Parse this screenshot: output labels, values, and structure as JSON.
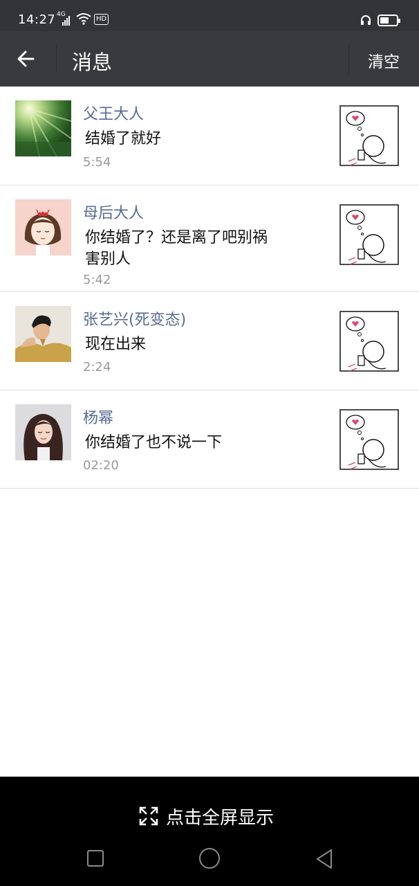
{
  "status_bar": {
    "time": "14:27",
    "signal": "4G",
    "hd": "HD",
    "battery_level": 0.55,
    "icons": [
      "signal-icon",
      "wifi-icon",
      "hd-icon",
      "headset-icon",
      "battery-icon"
    ]
  },
  "header": {
    "title": "消息",
    "clear_label": "清空",
    "back_icon": "back-arrow-icon"
  },
  "messages": [
    {
      "sender": "父王大人",
      "text": "结婚了就好",
      "time": "5:54"
    },
    {
      "sender": "母后大人",
      "text": "你结婚了？还是离了吧别祸害别人",
      "time": "5:42"
    },
    {
      "sender": "张艺兴(死变态)",
      "text": "现在出来",
      "time": "2:24"
    },
    {
      "sender": "杨幂",
      "text": "你结婚了也不说一下",
      "time": "02:20"
    }
  ],
  "fullscreen": {
    "label": "点击全屏显示",
    "icon": "expand-icon"
  },
  "nav_bar": {
    "icons": [
      "recent-apps-icon",
      "home-icon",
      "back-icon"
    ]
  },
  "colors": {
    "status_bar_bg": "#323437",
    "title_bar_bg": "#393a3f",
    "sender_name": "#576b95",
    "timestamp": "#999999",
    "bottom_bar_bg": "#000000"
  }
}
